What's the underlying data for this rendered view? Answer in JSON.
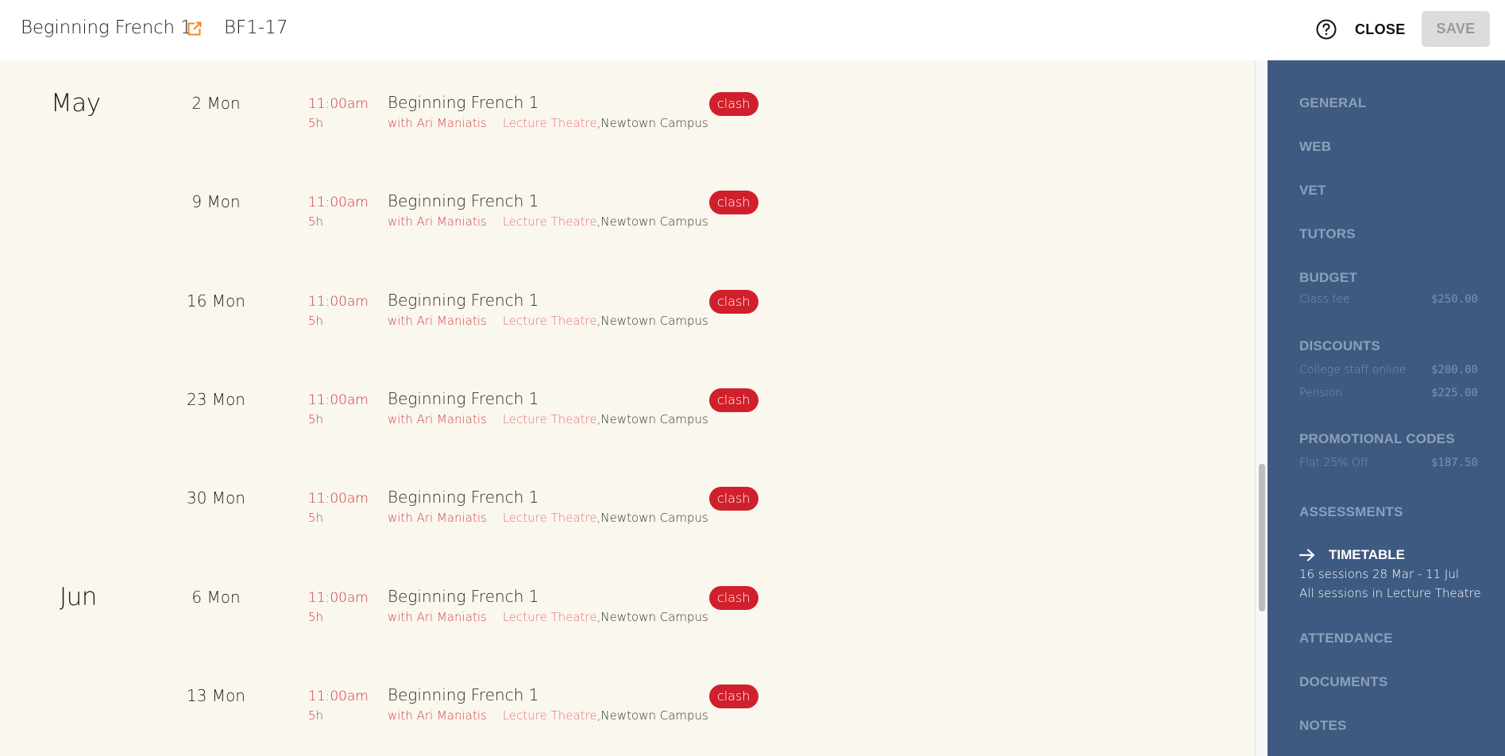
{
  "header": {
    "title": "Beginning French 1",
    "code": "BF1-17",
    "close_label": "CLOSE",
    "save_label": "SAVE",
    "accent_color": "#f08a24"
  },
  "sessions": [
    {
      "month": "May",
      "day": "2 Mon",
      "time": "11:00am",
      "duration": "5h",
      "title": "Beginning French 1",
      "tutor": "with Ari Maniatis",
      "room": "Lecture Theatre",
      "site": ",Newtown Campus",
      "badge": "clash"
    },
    {
      "month": "",
      "day": "9 Mon",
      "time": "11:00am",
      "duration": "5h",
      "title": "Beginning French 1",
      "tutor": "with Ari Maniatis",
      "room": "Lecture Theatre",
      "site": ",Newtown Campus",
      "badge": "clash"
    },
    {
      "month": "",
      "day": "16 Mon",
      "time": "11:00am",
      "duration": "5h",
      "title": "Beginning French 1",
      "tutor": "with Ari Maniatis",
      "room": "Lecture Theatre",
      "site": ",Newtown Campus",
      "badge": "clash"
    },
    {
      "month": "",
      "day": "23 Mon",
      "time": "11:00am",
      "duration": "5h",
      "title": "Beginning French 1",
      "tutor": "with Ari Maniatis",
      "room": "Lecture Theatre",
      "site": ",Newtown Campus",
      "badge": "clash"
    },
    {
      "month": "",
      "day": "30 Mon",
      "time": "11:00am",
      "duration": "5h",
      "title": "Beginning French 1",
      "tutor": "with Ari Maniatis",
      "room": "Lecture Theatre",
      "site": ",Newtown Campus",
      "badge": "clash"
    },
    {
      "month": "Jun",
      "day": "6 Mon",
      "time": "11:00am",
      "duration": "5h",
      "title": "Beginning French 1",
      "tutor": "with Ari Maniatis",
      "room": "Lecture Theatre",
      "site": ",Newtown Campus",
      "badge": "clash"
    },
    {
      "month": "",
      "day": "13 Mon",
      "time": "11:00am",
      "duration": "5h",
      "title": "Beginning French 1",
      "tutor": "with Ari Maniatis",
      "room": "Lecture Theatre",
      "site": ",Newtown Campus",
      "badge": "clash"
    }
  ],
  "sidebar": {
    "general": "GENERAL",
    "web": "WEB",
    "vet": "VET",
    "tutors": "TUTORS",
    "budget": {
      "label": "BUDGET",
      "items": [
        {
          "name": "Class fee",
          "amount": "$250.00"
        }
      ]
    },
    "discounts": {
      "label": "DISCOUNTS",
      "items": [
        {
          "name": "College staff online",
          "amount": "$200.00"
        },
        {
          "name": "Pension",
          "amount": "$225.00"
        }
      ]
    },
    "promotional_codes": {
      "label": "PROMOTIONAL CODES",
      "items": [
        {
          "name": "Flat 25% Off",
          "amount": "$187.50"
        }
      ]
    },
    "assessments": "ASSESSMENTS",
    "timetable": {
      "label": "TIMETABLE",
      "summary": "16 sessions 28 Mar - 11 Jul",
      "location": "All sessions in Lecture Theatre"
    },
    "attendance": "ATTENDANCE",
    "documents": "DOCUMENTS",
    "notes": "NOTES"
  },
  "colors": {
    "main_bg": "#faf7ee",
    "sidebar_bg": "#3e5a80",
    "clash_badge": "#d0202c",
    "time_text": "#c9353f"
  }
}
